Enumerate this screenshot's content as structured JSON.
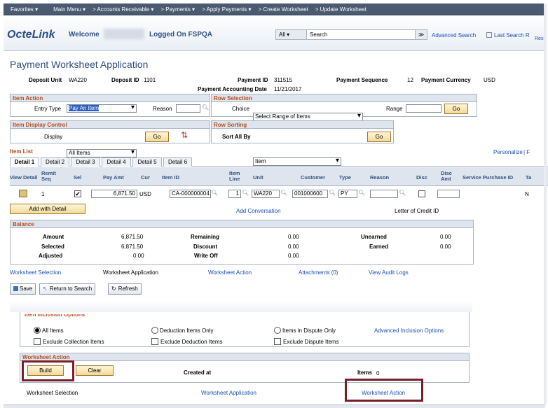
{
  "topnav": {
    "favorites": "Favorites ▾",
    "main_menu": "Main Menu ▾",
    "breadcrumb": [
      "> Accounts Receivable ▾",
      "> Payments ▾",
      "> Apply Payments ▾",
      "> Create Worksheet",
      "> Update Worksheet"
    ]
  },
  "header": {
    "logo": "OcteLink",
    "welcome": "Welcome",
    "logged_on": "Logged On FSPQA",
    "search_scope": "All",
    "search_placeholder": "Search",
    "search_go": "≫",
    "advanced_search": "Advanced Search",
    "last_search": "Last Search R",
    "edge_text": "Resu"
  },
  "page": {
    "title": "Payment Worksheet Application",
    "deposit_unit_label": "Deposit Unit",
    "deposit_unit": "WA220",
    "deposit_id_label": "Deposit ID",
    "deposit_id": "1101",
    "payment_id_label": "Payment ID",
    "payment_id": "311515",
    "payment_seq_label": "Payment Sequence",
    "payment_seq": "12",
    "payment_currency_label": "Payment Currency",
    "payment_currency": "USD",
    "payment_acct_date_label": "Payment Accounting Date",
    "payment_acct_date": "11/21/2017"
  },
  "item_action": {
    "header": "Item Action",
    "entry_type_label": "Entry Type",
    "entry_type_value": "Pay An Item",
    "reason_label": "Reason"
  },
  "row_selection": {
    "header": "Row Selection",
    "choice_label": "Choice",
    "choice_value": "Select Range of Items",
    "range_label": "Range",
    "go": "Go"
  },
  "item_display": {
    "header": "Item Display Control",
    "display_label": "Display",
    "display_value": "All Items",
    "go": "Go"
  },
  "row_sorting": {
    "header": "Row Sorting",
    "sort_label": "Sort All By",
    "sort_value": "Item",
    "go": "Go"
  },
  "item_list": {
    "header": "Item List",
    "personalize": "Personalize",
    "personalize_sep": "| F",
    "tabs": [
      "Detail 1",
      "Detail 2",
      "Detail 3",
      "Detail 4",
      "Detail 5",
      "Detail 6"
    ],
    "columns": {
      "view_detail": "View Detail",
      "remit_seq": "Remit Seq",
      "sel": "Sel",
      "pay_amt": "Pay Amt",
      "cur": "Cur",
      "item_id": "Item ID",
      "item_line": "Item Line",
      "unit": "Unit",
      "customer": "Customer",
      "type": "Type",
      "reason": "Reason",
      "disc": "Disc",
      "disc_amt": "Disc Amt",
      "service_purchase_id": "Service Purchase ID",
      "ta": "Ta"
    },
    "row": {
      "remit_seq": "1",
      "sel": "✔",
      "pay_amt": "6,871.50",
      "cur": "USD",
      "item_id": "CA-000000004",
      "item_line": "1",
      "unit": "WA220",
      "customer": "001000600",
      "type": "PY",
      "ta": "N"
    },
    "add_with_detail": "Add with Detail",
    "add_conversation": "Add Conversation",
    "letter_of_credit": "Letter of Credit ID"
  },
  "balance": {
    "header": "Balance",
    "amount_label": "Amount",
    "amount": "6,871.50",
    "selected_label": "Selected",
    "selected": "6,871.50",
    "adjusted_label": "Adjusted",
    "adjusted": "0.00",
    "remaining_label": "Remaining",
    "remaining": "0.00",
    "discount_label": "Discount",
    "discount": "0.00",
    "writeoff_label": "Write Off",
    "writeoff": "0.00",
    "unearned_label": "Unearned",
    "unearned": "0.00",
    "earned_label": "Earned",
    "earned": "0.00"
  },
  "links1": {
    "worksheet_selection": "Worksheet Selection",
    "worksheet_application": "Worksheet Application",
    "worksheet_action": "Worksheet Action",
    "attachments": "Attachments (0)",
    "view_audit_logs": "View Audit Logs"
  },
  "toolbar": {
    "save": "Save",
    "return_to_search": "Return to Search",
    "refresh": "Refresh"
  },
  "inclusion": {
    "header": "Item Inclusion Options",
    "all_items": "All Items",
    "deduction_only": "Deduction Items Only",
    "dispute_only": "Items in Dispute Only",
    "advanced": "Advanced Inclusion Options",
    "excl_collection": "Exclude Collection Items",
    "excl_deduction": "Exclude Deduction Items",
    "excl_dispute": "Exclude Dispute Items"
  },
  "worksheet_action": {
    "header": "Worksheet Action",
    "build": "Build",
    "clear": "Clear",
    "created_at": "Created at",
    "items_label": "Items",
    "items": "0"
  },
  "links2": {
    "worksheet_selection": "Worksheet Selection",
    "worksheet_application": "Worksheet Application",
    "worksheet_action": "Worksheet Action"
  },
  "colors": {
    "header_orange": "#b24c1a",
    "link_blue": "#1a4fb5",
    "highlight_red": "#7a1d2b",
    "nav_bg": "#4a5a70"
  }
}
